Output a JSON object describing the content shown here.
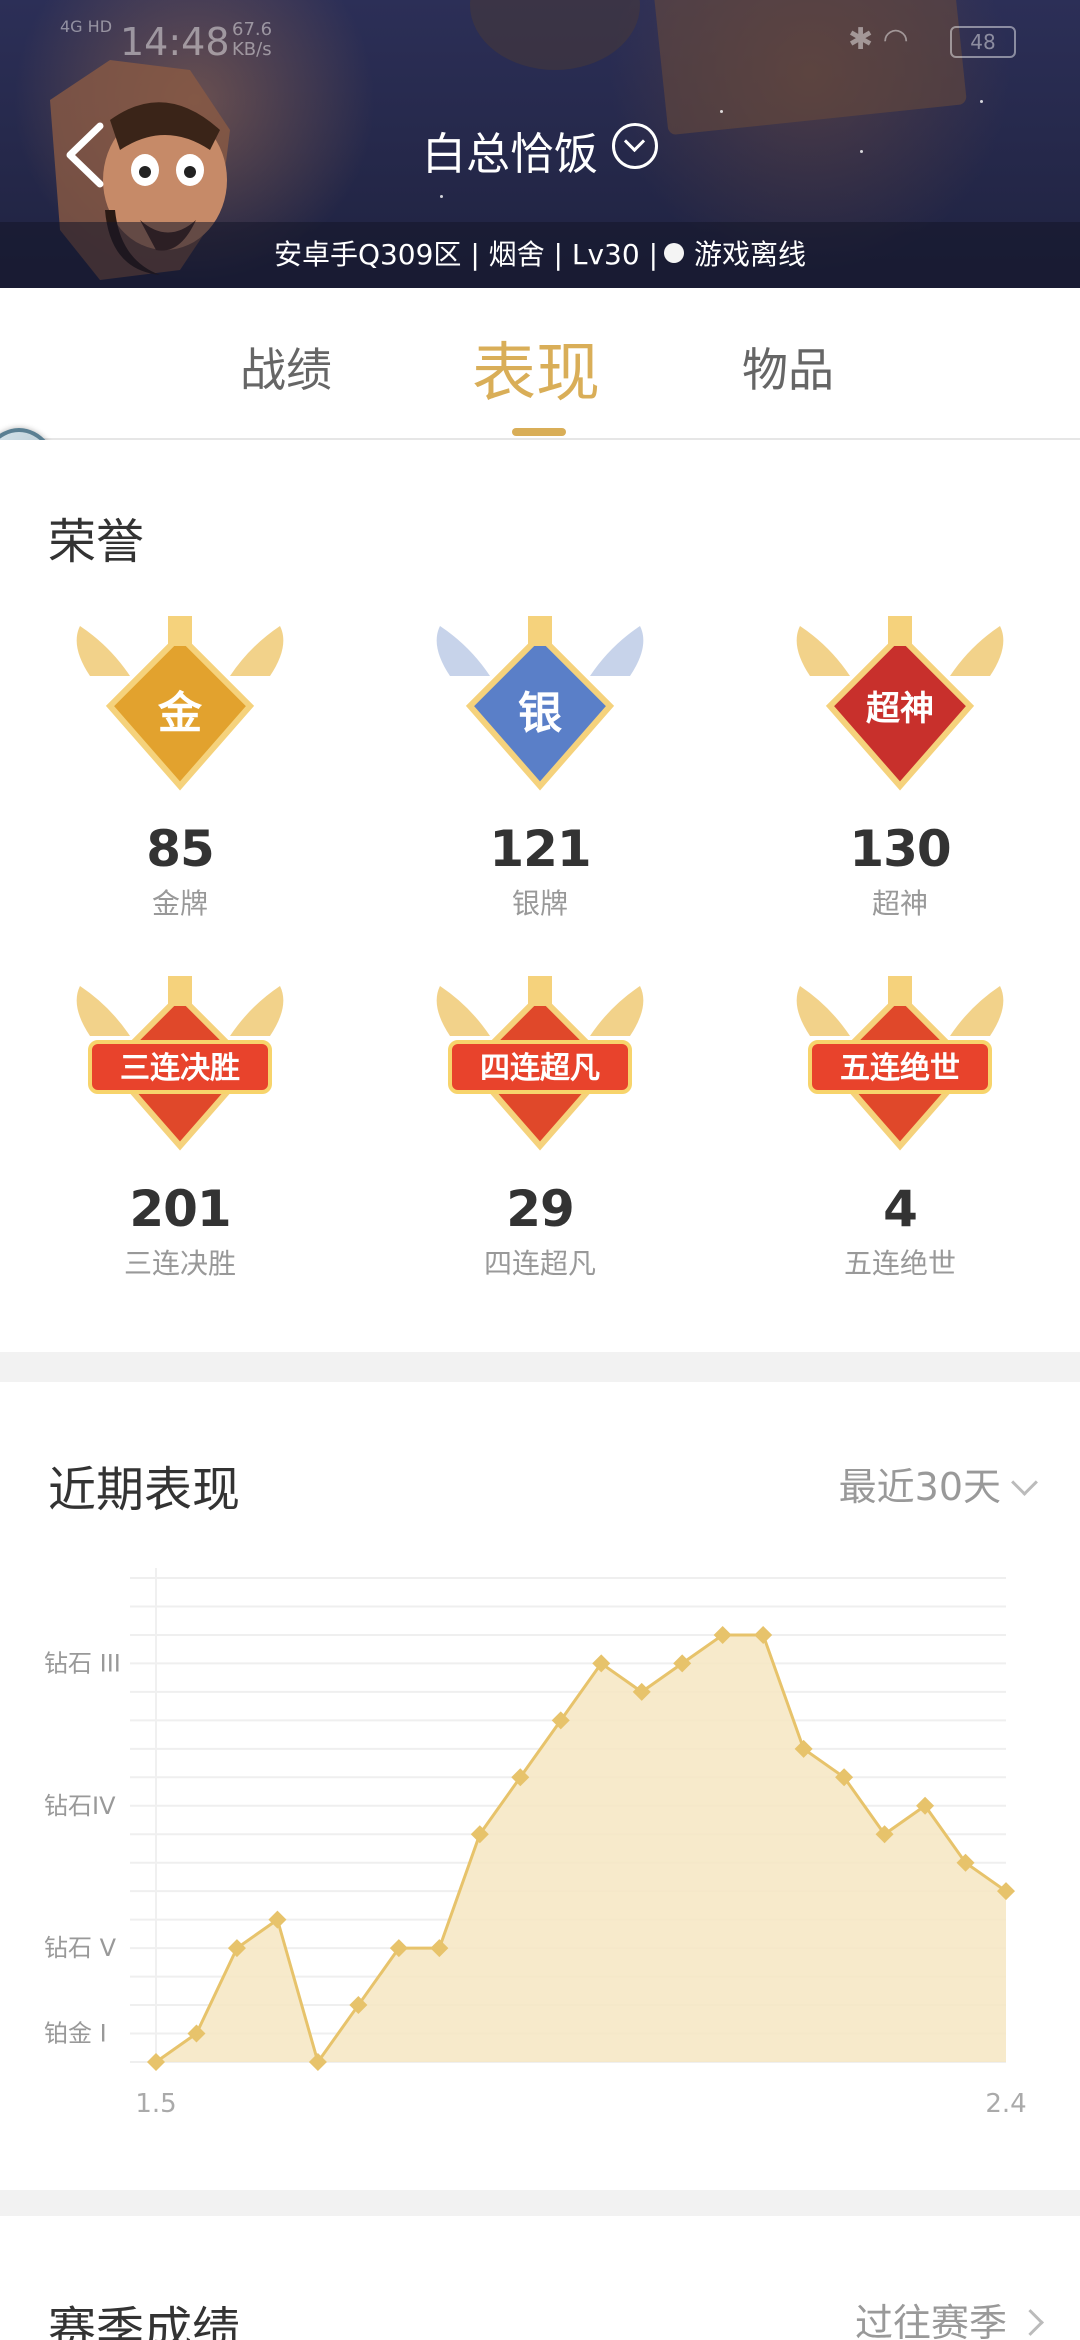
{
  "status_bar": {
    "network": "4G HD",
    "time": "14:48",
    "speed": "67.6",
    "speed_unit": "KB/s",
    "battery": "48"
  },
  "header": {
    "title": "白总恰饭",
    "subinfo": "安卓手Q309区 | 烟舍 | Lv30 |",
    "online_status": "游戏离线"
  },
  "tabs": [
    "战绩",
    "表现",
    "物品"
  ],
  "active_tab": 1,
  "honors": {
    "title": "荣誉",
    "items": [
      {
        "value": "85",
        "label": "金牌",
        "badge_text": "金",
        "color": "#e2a22e"
      },
      {
        "value": "121",
        "label": "银牌",
        "badge_text": "银",
        "color": "#5a7fc8"
      },
      {
        "value": "130",
        "label": "超神",
        "badge_text": "超神",
        "color": "#c8302c"
      },
      {
        "value": "201",
        "label": "三连决胜",
        "badge_text": "三连决胜",
        "color": "#e0482a"
      },
      {
        "value": "29",
        "label": "四连超凡",
        "badge_text": "四连超凡",
        "color": "#e0482a"
      },
      {
        "value": "4",
        "label": "五连绝世",
        "badge_text": "五连绝世",
        "color": "#e0482a"
      }
    ]
  },
  "recent": {
    "title": "近期表现",
    "range_label": "最近30天",
    "range_value": "30"
  },
  "chart_data": {
    "type": "area",
    "xlabel": "",
    "ylabel": "",
    "y_tick_labels": [
      "铂金 I",
      "钻石 V",
      "钻石IV",
      "钻石 III"
    ],
    "x_tick_labels": [
      "1.5",
      "2.4"
    ],
    "ylim": [
      0,
      17
    ],
    "values": [
      0,
      1,
      4,
      5,
      0,
      2,
      4,
      4,
      8,
      10,
      12,
      14,
      13,
      14,
      15,
      15,
      11,
      10,
      8,
      9,
      7,
      6
    ],
    "grid": true,
    "line_color": "#e7c36b",
    "fill_color": "#f6e6c2"
  },
  "season": {
    "title": "赛季成绩",
    "past_label": "过往赛季"
  }
}
